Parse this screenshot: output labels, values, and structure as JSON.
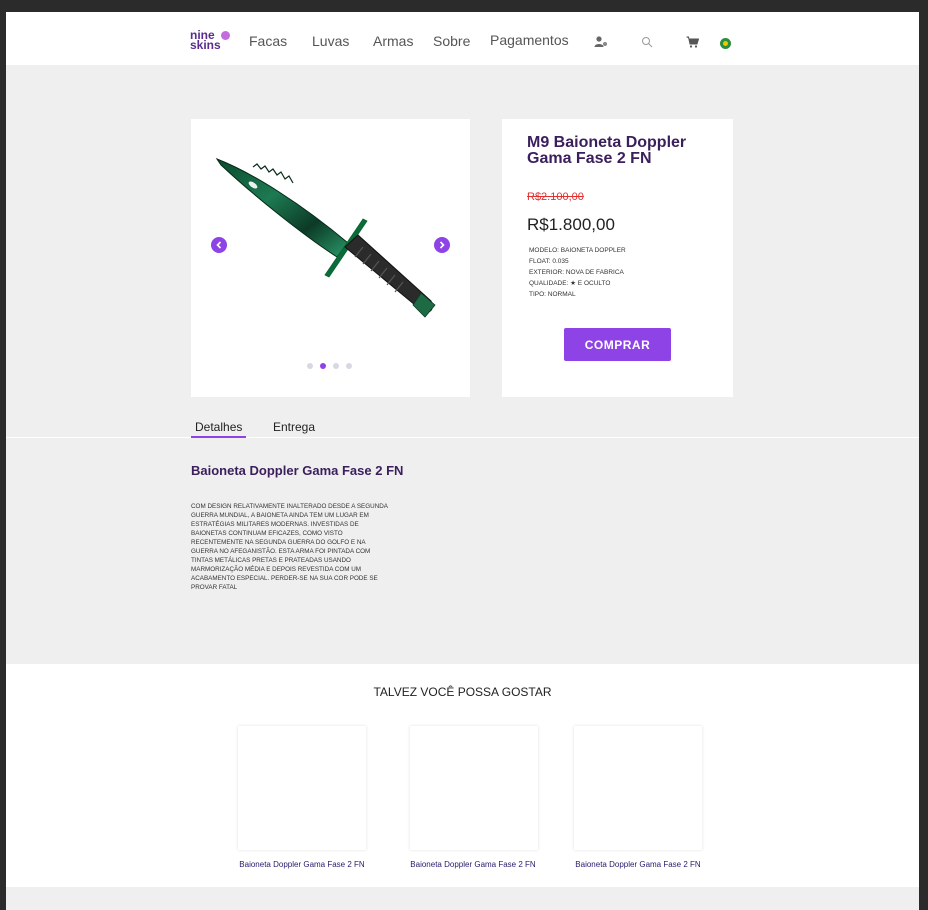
{
  "brand": {
    "line1": "nine",
    "line2": "skins"
  },
  "nav": {
    "items": [
      "Facas",
      "Luvas",
      "Armas",
      "Sobre",
      "Pagamentos"
    ]
  },
  "icons": {
    "user": "user-icon",
    "search": "search-icon",
    "cart": "cart-icon",
    "flag": "brazil-flag-icon"
  },
  "product": {
    "title": "M9 Baioneta Doppler Gama Fase 2 FN",
    "old_price": "R$2.100,00",
    "price": "R$1.800,00",
    "specs": [
      "MODELO: BAIONETA DOPPLER",
      "FLOAT: 0.035",
      "EXTERIOR: NOVA DE FABRICA",
      "QUALIDADE: ★ E OCULTO",
      "TIPO: NORMAL"
    ],
    "buy_label": "COMPRAR",
    "carousel": {
      "total": 4,
      "active": 2
    }
  },
  "tabs": [
    "Detalhes",
    "Entrega"
  ],
  "details": {
    "title": "Baioneta Doppler Gama Fase 2 FN",
    "text": "COM DESIGN RELATIVAMENTE INALTERADO DESDE A SEGUNDA GUERRA MUNDIAL, A BAIONETA AINDA TEM UM LUGAR EM ESTRATÉGIAS MILITARES MODERNAS. INVESTIDAS DE BAIONETAS CONTINUAM EFICAZES, COMO VISTO RECENTEMENTE NA SEGUNDA GUERRA DO GOLFO E NA GUERRA NO AFEGANISTÃO. ESTA ARMA FOI PINTADA COM TINTAS METÁLICAS PRETAS E PRATEADAS USANDO MARMORIZAÇÃO MÉDIA E DEPOIS REVESTIDA COM UM ACABAMENTO ESPECIAL. PERDER-SE NA SUA COR PODE SE PROVAR FATAL"
  },
  "recommendations": {
    "title": "TALVEZ VOCÊ POSSA GOSTAR",
    "items": [
      {
        "label": "Baioneta Doppler Gama Fase 2 FN"
      },
      {
        "label": "Baioneta Doppler Gama Fase 2 FN"
      },
      {
        "label": "Baioneta Doppler Gama Fase 2 FN"
      }
    ]
  },
  "colors": {
    "accent": "#8e43e6",
    "brand": "#5b2d8e",
    "old_price": "#e03030"
  }
}
